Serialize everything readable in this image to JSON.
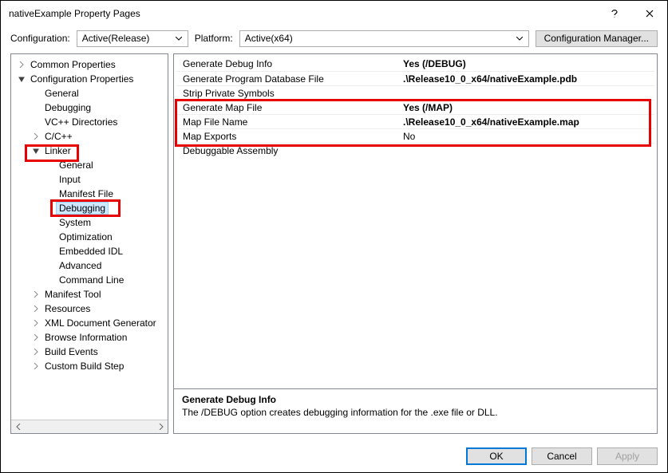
{
  "window_title": "nativeExample Property Pages",
  "config_label": "Configuration:",
  "config_value": "Active(Release)",
  "platform_label": "Platform:",
  "platform_value": "Active(x64)",
  "configmgr_label": "Configuration Manager...",
  "tree": {
    "common": "Common Properties",
    "cfgprops": "Configuration Properties",
    "general": "General",
    "debugging": "Debugging",
    "vcpp": "VC++ Directories",
    "cc": "C/C++",
    "linker": "Linker",
    "l_general": "General",
    "l_input": "Input",
    "l_manifest": "Manifest File",
    "l_debugging": "Debugging",
    "l_system": "System",
    "l_optimization": "Optimization",
    "l_embeddedidl": "Embedded IDL",
    "l_advanced": "Advanced",
    "l_cmdline": "Command Line",
    "manifest_tool": "Manifest Tool",
    "resources": "Resources",
    "xmldocgen": "XML Document Generator",
    "browse": "Browse Information",
    "buildevents": "Build Events",
    "custombuild": "Custom Build Step"
  },
  "props": {
    "p0l": "Generate Debug Info",
    "p0v": "Yes (/DEBUG)",
    "p1l": "Generate Program Database File",
    "p1v": ".\\Release10_0_x64/nativeExample.pdb",
    "p2l": "Strip Private Symbols",
    "p2v": "",
    "p3l": "Generate Map File",
    "p3v": "Yes (/MAP)",
    "p4l": "Map File Name",
    "p4v": ".\\Release10_0_x64/nativeExample.map",
    "p5l": "Map Exports",
    "p5v": "No",
    "p6l": "Debuggable Assembly",
    "p6v": ""
  },
  "desc_title": "Generate Debug Info",
  "desc_text": "The /DEBUG option creates debugging information for the .exe file or DLL.",
  "btn_ok": "OK",
  "btn_cancel": "Cancel",
  "btn_apply": "Apply"
}
